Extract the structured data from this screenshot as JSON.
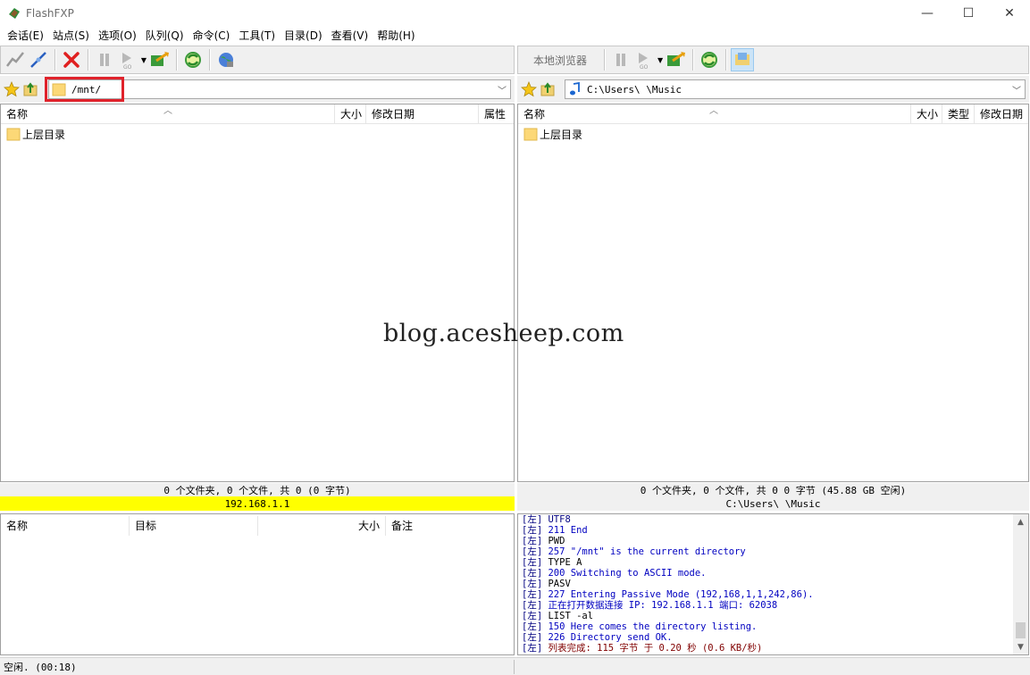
{
  "window": {
    "title": "FlashFXP",
    "minimize": "—",
    "maximize": "☐",
    "close": "✕"
  },
  "menu": [
    "会话(E)",
    "站点(S)",
    "选项(O)",
    "队列(Q)",
    "命令(C)",
    "工具(T)",
    "目录(D)",
    "查看(V)",
    "帮助(H)"
  ],
  "left": {
    "path": "/mnt/",
    "columns": {
      "name": "名称",
      "size": "大小",
      "modified": "修改日期",
      "attr": "属性"
    },
    "rows": [
      {
        "name": "上层目录"
      }
    ],
    "summary": "0 个文件夹, 0 个文件, 共 0 (0 字节)",
    "host": "192.168.1.1"
  },
  "right": {
    "browser_label": "本地浏览器",
    "path": "C:\\Users\\      \\Music",
    "columns": {
      "name": "名称",
      "size": "大小",
      "type": "类型",
      "modified": "修改日期"
    },
    "rows": [
      {
        "name": "上层目录"
      }
    ],
    "summary": "0 个文件夹, 0 个文件, 共 0 0 字节 (45.88 GB 空闲)",
    "path_status": "C:\\Users\\      \\Music"
  },
  "queue": {
    "columns": {
      "name": "名称",
      "target": "目标",
      "size": "大小",
      "note": "备注"
    }
  },
  "log": {
    "lines": [
      {
        "tag": "[左]",
        "text": " UTF8",
        "color": "#000080"
      },
      {
        "tag": "[左]",
        "text": "211 End",
        "color": "#0000c0"
      },
      {
        "tag": "[左]",
        "text": "PWD",
        "color": "#000000"
      },
      {
        "tag": "[左]",
        "text": "257 \"/mnt\" is the current directory",
        "color": "#0000c0"
      },
      {
        "tag": "[左]",
        "text": "TYPE A",
        "color": "#000000"
      },
      {
        "tag": "[左]",
        "text": "200 Switching to ASCII mode.",
        "color": "#0000c0"
      },
      {
        "tag": "[左]",
        "text": "PASV",
        "color": "#000000"
      },
      {
        "tag": "[左]",
        "text": "227 Entering Passive Mode (192,168,1,1,242,86).",
        "color": "#0000c0"
      },
      {
        "tag": "[左]",
        "text": "正在打开数据连接 IP: 192.168.1.1 端口: 62038",
        "color": "#0000c0"
      },
      {
        "tag": "[左]",
        "text": "LIST -al",
        "color": "#000000"
      },
      {
        "tag": "[左]",
        "text": "150 Here comes the directory listing.",
        "color": "#0000c0"
      },
      {
        "tag": "[左]",
        "text": "226 Directory send OK.",
        "color": "#0000c0"
      },
      {
        "tag": "[左]",
        "text": "列表完成: 115 字节 于 0.20 秒 (0.6 KB/秒)",
        "color": "#800000"
      }
    ]
  },
  "status": {
    "text": "空闲. (00:18)"
  },
  "watermark": "blog.acesheep.com",
  "colors": {
    "host_bar": "#ffff00",
    "highlight": "#e0222b"
  },
  "icons": [
    "flashfxp-app-icon",
    "connect-icon",
    "quick-connect-icon",
    "disconnect-icon",
    "pause-icon",
    "transfer-go-icon",
    "transfer-all-icon",
    "refresh-icon",
    "globe-icon",
    "favorites-star-icon",
    "parent-dir-icon",
    "folder-icon",
    "music-note-icon",
    "local-browser-icon"
  ]
}
